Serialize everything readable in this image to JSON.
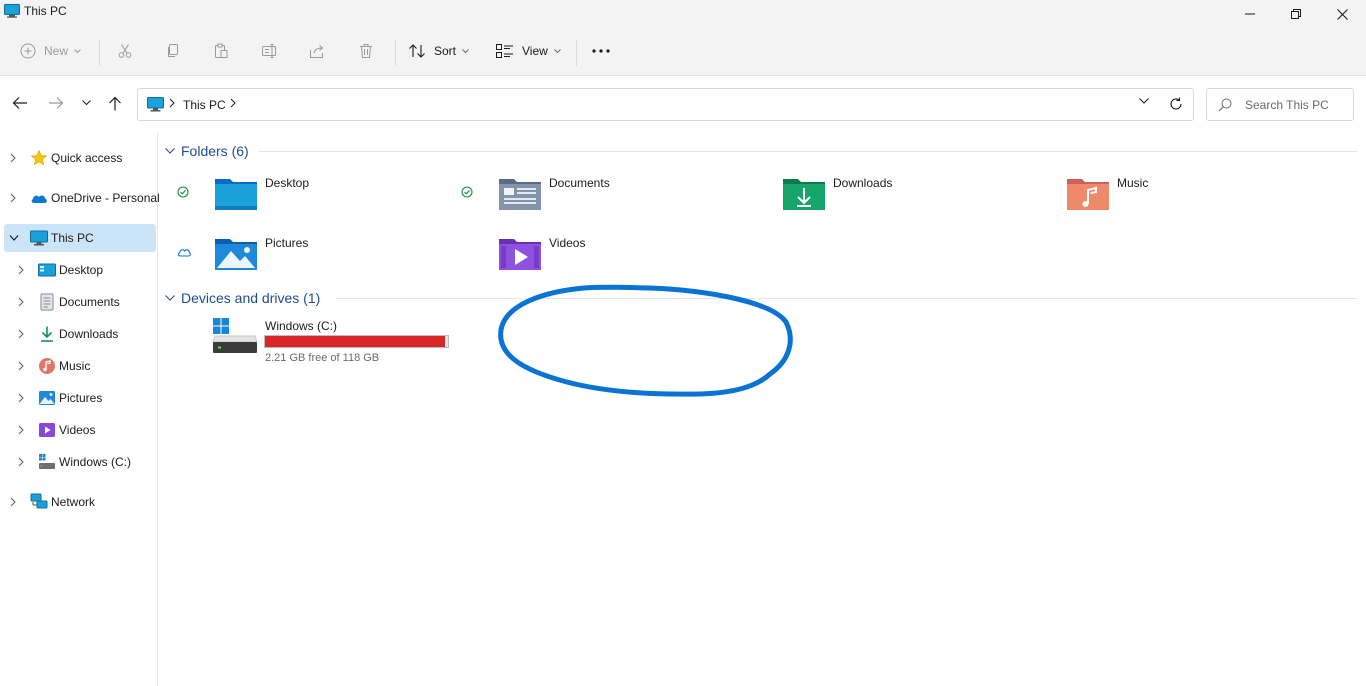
{
  "window": {
    "title": "This PC",
    "controls": [
      "minimize",
      "restore",
      "close"
    ]
  },
  "toolbar": {
    "new_label": "New",
    "sort_label": "Sort",
    "view_label": "View",
    "disabled_actions": [
      "cut",
      "copy",
      "paste",
      "rename",
      "share",
      "delete"
    ]
  },
  "address": {
    "breadcrumb": [
      "This PC"
    ],
    "search_placeholder": "Search This PC"
  },
  "sidebar": {
    "items": [
      {
        "label": "Quick access",
        "icon": "star-icon"
      },
      {
        "label": "OneDrive - Personal",
        "icon": "onedrive-cloud-icon"
      },
      {
        "label": "This PC",
        "icon": "computer-icon",
        "selected": true,
        "expanded": true
      },
      {
        "label": "Desktop",
        "icon": "desktop-icon"
      },
      {
        "label": "Documents",
        "icon": "documents-icon"
      },
      {
        "label": "Downloads",
        "icon": "download-icon"
      },
      {
        "label": "Music",
        "icon": "music-icon"
      },
      {
        "label": "Pictures",
        "icon": "pictures-icon"
      },
      {
        "label": "Videos",
        "icon": "videos-icon"
      },
      {
        "label": "Windows (C:)",
        "icon": "drive-icon"
      },
      {
        "label": "Network",
        "icon": "network-icon"
      }
    ]
  },
  "content": {
    "folders_header": "Folders (6)",
    "devices_header": "Devices and drives (1)",
    "folders": [
      {
        "name": "Desktop",
        "status": "synced-check"
      },
      {
        "name": "Documents",
        "status": "synced-check"
      },
      {
        "name": "Downloads",
        "status": ""
      },
      {
        "name": "Music",
        "status": ""
      },
      {
        "name": "Pictures",
        "status": "cloud"
      },
      {
        "name": "Videos",
        "status": ""
      }
    ],
    "drives": [
      {
        "name": "Windows (C:)",
        "free_text": "2.21 GB free of 118 GB",
        "used_fraction": 0.981
      }
    ]
  },
  "colors": {
    "accent": "#0067c0",
    "selected_bg": "#cce4f7",
    "drive_bar_critical": "#da2626",
    "annotation_stroke": "#0a73d4"
  }
}
